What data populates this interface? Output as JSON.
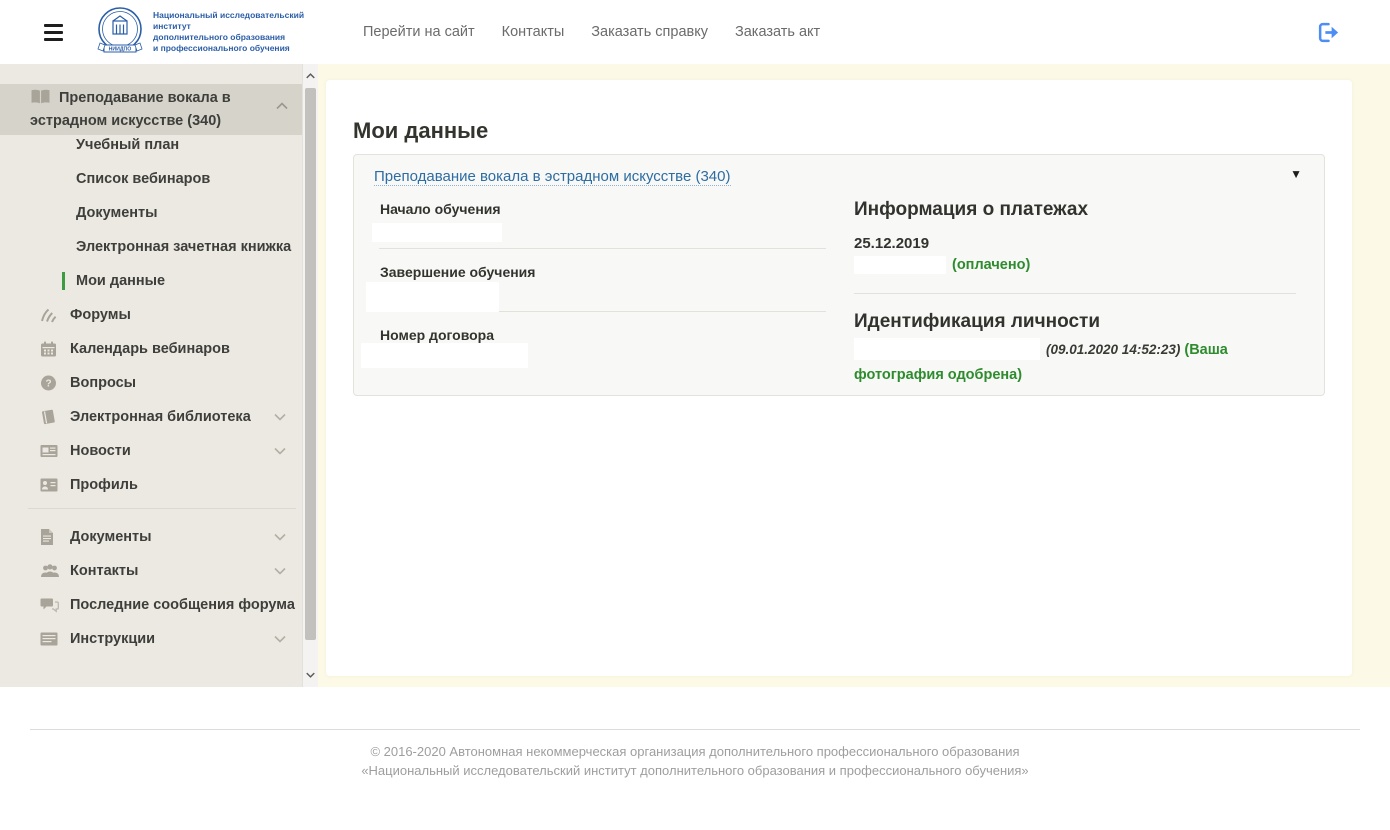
{
  "colors": {
    "accent_blue": "#2d6da3",
    "logo_blue": "#2b5ea7",
    "logout_blue": "#4d8df6",
    "success_green": "#2e8b2e",
    "active_marker_green": "#3f9b3f",
    "main_bg_cream": "#fcfae6",
    "sidebar_bg": "#ece9e2",
    "sidebar_active_bg": "#d6d3cb"
  },
  "header": {
    "logo": {
      "line1": "Национальный исследовательский институт",
      "line2": "дополнительного образования",
      "line3": "и профессионального обучения",
      "abbr": "НИИДПО"
    },
    "nav": [
      {
        "label": "Перейти на сайт"
      },
      {
        "label": "Контакты"
      },
      {
        "label": "Заказать справку"
      },
      {
        "label": "Заказать акт"
      }
    ]
  },
  "sidebar": {
    "course": {
      "label": "Преподавание вокала в эстрадном искусстве (340)",
      "icon": "open-book-icon",
      "expanded": true
    },
    "course_sub": [
      {
        "label": "Учебный план"
      },
      {
        "label": "Список вебинаров"
      },
      {
        "label": "Документы"
      },
      {
        "label": "Электронная зачетная книжка"
      },
      {
        "label": "Мои данные",
        "active": true
      }
    ],
    "items": [
      {
        "label": "Форумы",
        "icon": "forum-icon",
        "chevron": false
      },
      {
        "label": "Календарь вебинаров",
        "icon": "calendar-icon",
        "chevron": false
      },
      {
        "label": "Вопросы",
        "icon": "question-icon",
        "chevron": false
      },
      {
        "label": "Электронная библиотека",
        "icon": "library-icon",
        "chevron": true
      },
      {
        "label": "Новости",
        "icon": "news-icon",
        "chevron": true
      },
      {
        "label": "Профиль",
        "icon": "profile-icon",
        "chevron": false
      }
    ],
    "items2": [
      {
        "label": "Документы",
        "icon": "document-icon",
        "chevron": true
      },
      {
        "label": "Контакты",
        "icon": "contacts-icon",
        "chevron": true
      },
      {
        "label": "Последние сообщения форума",
        "icon": "messages-icon",
        "chevron": false
      },
      {
        "label": "Инструкции",
        "icon": "instructions-icon",
        "chevron": true
      }
    ]
  },
  "main": {
    "title": "Мои данные",
    "card": {
      "course_link": "Преподавание вокала в эстрадном искусстве (340)",
      "caret": "▼",
      "fields": [
        {
          "label": "Начало обучения",
          "value_redacted": true
        },
        {
          "label": "Завершение обучения",
          "value_redacted": true
        },
        {
          "label": "Номер договора",
          "value_redacted": true
        }
      ],
      "payments": {
        "title": "Информация о платежах",
        "date": "25.12.2019",
        "status": "(оплачено)"
      },
      "identity": {
        "title": "Идентификация личности",
        "timestamp": "(09.01.2020 14:52:23)",
        "status": "(Ваша фотография одобрена)"
      }
    }
  },
  "footer": {
    "line1": "© 2016-2020 Автономная некоммерческая организация дополнительного профессионального образования",
    "line2": "«Национальный исследовательский институт дополнительного образования и профессионального обучения»"
  }
}
